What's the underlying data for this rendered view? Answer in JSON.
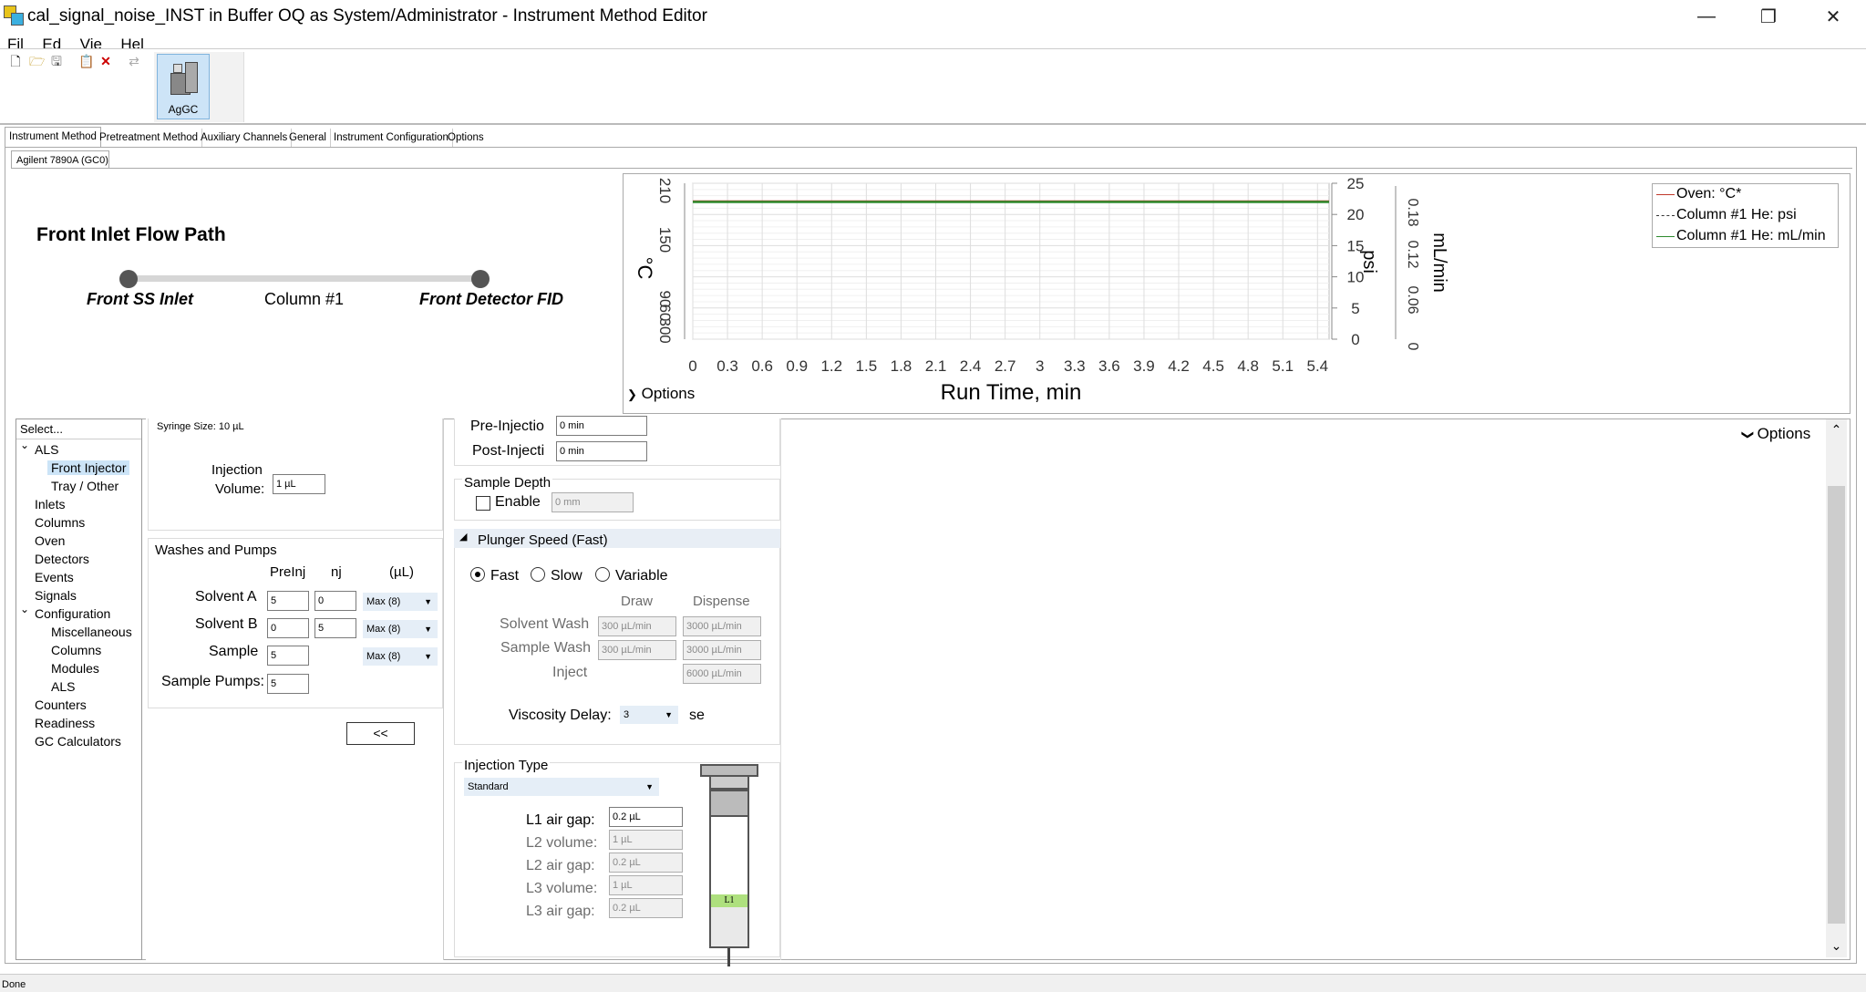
{
  "window": {
    "title": "cal_signal_noise_INST in Buffer OQ as System/Administrator - Instrument Method Editor",
    "minimize": "—",
    "restore": "❐",
    "close": "✕"
  },
  "menu": [
    "Fil",
    "Ed",
    "Vie",
    "Hel"
  ],
  "toolbar": {
    "new": "🗋",
    "open": "🗁",
    "save": "🖫",
    "paste": "📋",
    "delete": "✕",
    "refresh": "⇄"
  },
  "instrument_button": {
    "label": "AgGC"
  },
  "tabs": [
    "Instrument Method",
    "Pretreatment Method",
    "Auxiliary Channels",
    "General",
    "Instrument Configuration",
    "Options"
  ],
  "subtab": "Agilent 7890A (GC0)",
  "flow_path": {
    "title": "Front Inlet Flow Path",
    "start": "Front SS Inlet",
    "middle": "Column #1",
    "end": "Front Detector FID"
  },
  "chart_data": {
    "type": "line",
    "xlabel": "Run Time, min",
    "x_ticks": [
      "0",
      "0.3",
      "0.6",
      "0.9",
      "1.2",
      "1.5",
      "1.8",
      "2.1",
      "2.4",
      "2.7",
      "3",
      "3.3",
      "3.6",
      "3.9",
      "4.2",
      "4.5",
      "4.8",
      "5.1",
      "5.4"
    ],
    "xlim": [
      0,
      5.5
    ],
    "left_axis": {
      "label": "°C",
      "ticks": [
        "0",
        "30",
        "60",
        "90",
        "150",
        "210"
      ]
    },
    "right_axis1": {
      "label": "psi",
      "ticks": [
        "0",
        "5",
        "10",
        "15",
        "20",
        "25"
      ],
      "ylim": [
        0,
        25
      ]
    },
    "right_axis2": {
      "label": "mL/min",
      "ticks": [
        "0",
        "0.06",
        "0.12",
        "0.18"
      ]
    },
    "series": [
      {
        "name": "Oven: °C*",
        "color": "#c0392b",
        "y": 22
      },
      {
        "name": "Column #1 He: psi",
        "color": "#333333",
        "y": 22
      },
      {
        "name": "Column #1 He: mL/min",
        "color": "#2e8b2e",
        "y": 22
      }
    ],
    "options_label": "Options"
  },
  "tree": {
    "header": "Select...",
    "items": [
      {
        "t": "ALS",
        "lvl": 0,
        "exp": true
      },
      {
        "t": "Front Injector",
        "lvl": 1,
        "sel": true
      },
      {
        "t": "Tray / Other",
        "lvl": 1
      },
      {
        "t": "Inlets",
        "lvl": 0
      },
      {
        "t": "Columns",
        "lvl": 0
      },
      {
        "t": "Oven",
        "lvl": 0
      },
      {
        "t": "Detectors",
        "lvl": 0
      },
      {
        "t": "Events",
        "lvl": 0
      },
      {
        "t": "Signals",
        "lvl": 0
      },
      {
        "t": "Configuration",
        "lvl": 0,
        "exp": true
      },
      {
        "t": "Miscellaneous",
        "lvl": 1
      },
      {
        "t": "Columns",
        "lvl": 1
      },
      {
        "t": "Modules",
        "lvl": 1
      },
      {
        "t": "ALS",
        "lvl": 1
      },
      {
        "t": "Counters",
        "lvl": 0
      },
      {
        "t": "Readiness",
        "lvl": 0
      },
      {
        "t": "GC Calculators",
        "lvl": 0
      }
    ]
  },
  "syringe": {
    "size_label": "Syringe Size: 10 µL",
    "inj_vol_label1": "Injection",
    "inj_vol_label2": "Volume:",
    "inj_vol": "1 µL"
  },
  "washes": {
    "title": "Washes and Pumps",
    "col_preinj": "PreInj",
    "col_nj": "nj",
    "col_unit": "(µL)",
    "rows": [
      {
        "label": "Solvent A",
        "pre": "5",
        "post": "0",
        "max": "Max (8)"
      },
      {
        "label": "Solvent B",
        "pre": "0",
        "post": "5",
        "max": "Max (8)"
      },
      {
        "label": "Sample",
        "pre": "5",
        "max": "Max (8)"
      }
    ],
    "pumps_label": "Sample Pumps:",
    "pumps": "5",
    "collapse_btn": "<<"
  },
  "dwell": {
    "pre_label": "Pre-Injectio",
    "pre": "0 min",
    "post_label": "Post-Injecti",
    "post": "0 min"
  },
  "depth": {
    "title": "Sample Depth",
    "enable": "Enable",
    "value": "0 mm"
  },
  "plunger": {
    "title": "Plunger Speed (Fast)",
    "fast": "Fast",
    "slow": "Slow",
    "variable": "Variable",
    "draw": "Draw",
    "dispense": "Dispense",
    "solvent_wash": "Solvent Wash",
    "sw_draw": "300 µL/min",
    "sw_disp": "3000 µL/min",
    "sample_wash": "Sample Wash",
    "sa_draw": "300 µL/min",
    "sa_disp": "3000 µL/min",
    "inject": "Inject",
    "inj_disp": "6000 µL/min",
    "visc_label": "Viscosity Delay:",
    "visc": "3",
    "visc_unit": "se"
  },
  "injtype": {
    "title": "Injection Type",
    "value": "Standard",
    "l1air": "L1 air gap:",
    "l1air_v": "0.2 µL",
    "l2vol": "L2 volume:",
    "l2vol_v": "1 µL",
    "l2air": "L2 air gap:",
    "l2air_v": "0.2 µL",
    "l3vol": "L3 volume:",
    "l3vol_v": "1 µL",
    "l3air": "L3 air gap:",
    "l3air_v": "0.2 µL",
    "syr_label": "L1"
  },
  "right_options": "Options",
  "status": "Done"
}
